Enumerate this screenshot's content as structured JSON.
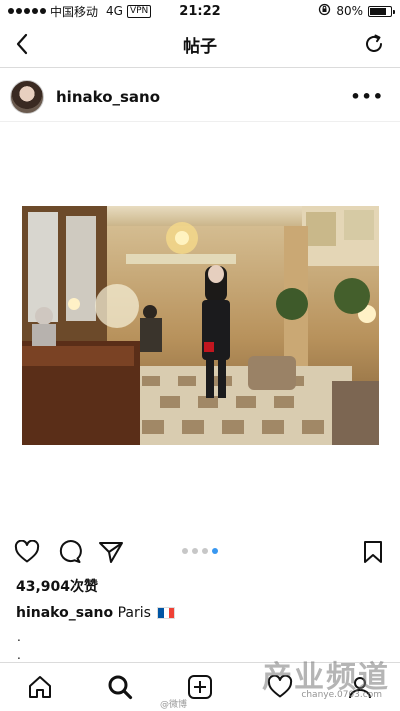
{
  "status_bar": {
    "carrier": "中国移动",
    "network": "4G",
    "vpn": "VPN",
    "time": "21:22",
    "battery_percent": "80%",
    "battery_level": 0.8
  },
  "header": {
    "title": "帖子",
    "back_icon": "chevron-left-icon",
    "refresh_icon": "refresh-icon"
  },
  "post": {
    "username": "hinako_sano",
    "more_label": "•••",
    "carousel": {
      "count": 4,
      "active_index": 3
    },
    "likes": "43,904次赞",
    "caption": {
      "username": "hinako_sano",
      "text": "Paris",
      "emoji": "french-flag-icon",
      "extra_lines": [
        ".",
        "."
      ]
    }
  },
  "tab_bar": {
    "items": [
      "home-icon",
      "search-icon",
      "add-icon",
      "heart-icon",
      "profile-icon"
    ]
  },
  "watermarks": {
    "main": "产业频道",
    "sub": "chanye.0703.com",
    "weibo": "@微博"
  },
  "colors": {
    "accent": "#3897f0",
    "border": "#dbdbdb",
    "text": "#111111"
  }
}
